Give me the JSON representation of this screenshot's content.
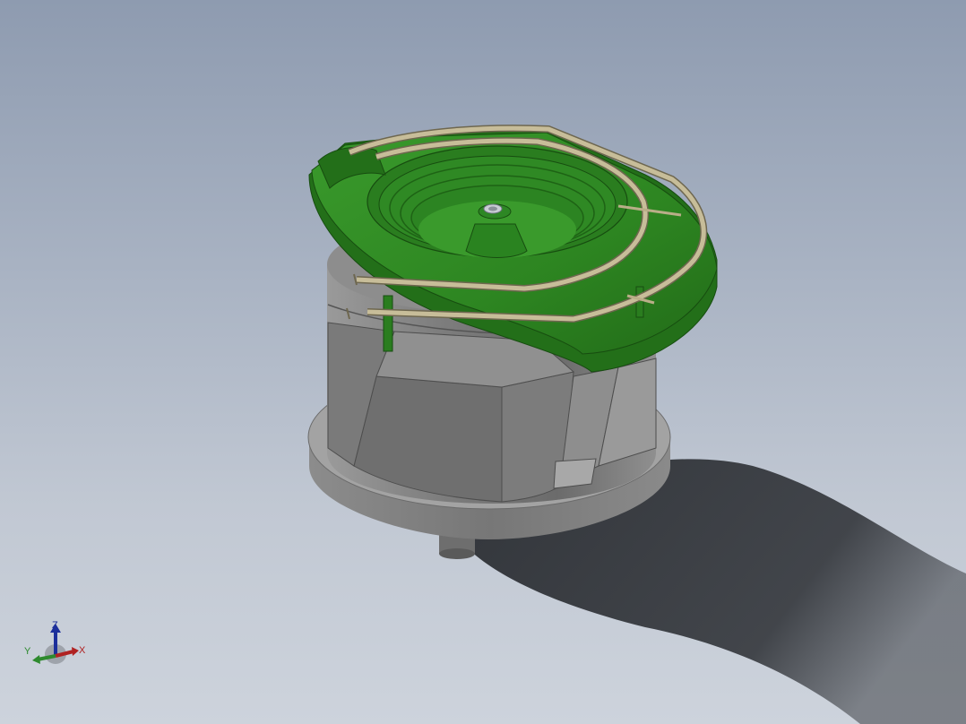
{
  "viewport": {
    "background_top": "#8e9bb0",
    "background_bottom": "#cdd3dc"
  },
  "model": {
    "bowl_color": "#2f8a22",
    "bowl_dark": "#1f6516",
    "base_color": "#8a8a8a",
    "base_dark": "#5f5f5f",
    "rail_color": "#bfb592",
    "shadow_color": "#2b2e33"
  },
  "triad": {
    "z_label": "Z",
    "y_label": "Y",
    "x_label": "X",
    "z_color": "#1c2f9b",
    "y_color": "#2e8a2e",
    "x_color": "#b02222"
  }
}
